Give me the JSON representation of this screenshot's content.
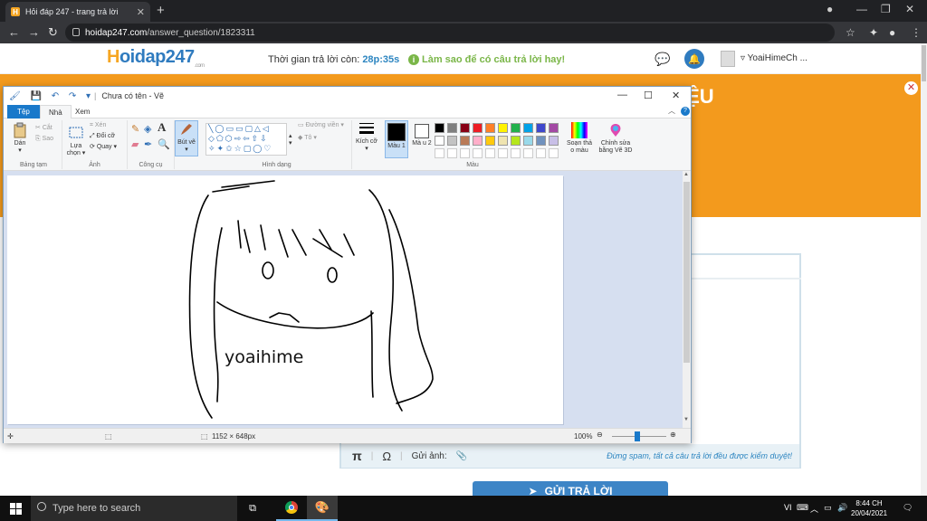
{
  "browser": {
    "tab_title": "Hỏi đáp 247 - trang trả lời",
    "url_host": "hoidap247.com",
    "url_path": "/answer_question/1823311"
  },
  "site": {
    "logo_main": "Hoidap247",
    "logo_sub": ".com",
    "timer_label": "Thời gian trả lời còn:",
    "timer_value": "28p:35s",
    "howto": "Làm sao để có câu trả lời hay!",
    "username": "YoaiHimeCh ...",
    "title_fragment": "IỆU",
    "answer_tools": {
      "pi": "π",
      "omega": "Ω",
      "image_label": "Gửi ảnh:",
      "note": "Đừng spam, tất cả câu trả lời đều được kiểm duyệt!"
    },
    "submit_label": "GỬI TRẢ LỜI"
  },
  "paint": {
    "doc_title": "Chưa có tên - Vẽ",
    "tabs": [
      "Tệp",
      "Nhà",
      "Xem"
    ],
    "groups": {
      "clipboard": "Bảng tạm",
      "image": "Ảnh",
      "tools": "Công cụ",
      "shapes": "Hình dạng",
      "colors": "Màu"
    },
    "buttons": {
      "paste": "Dán",
      "cut": "Cắt",
      "copy": "Sao",
      "select": "Lựa chọn",
      "crop": "Xén",
      "resize": "Đổi cỡ",
      "rotate": "Quay",
      "brush": "Bút vẽ",
      "outline": "Đường viền",
      "fill": "Tô",
      "size": "Kích cỡ",
      "color1": "Màu 1",
      "color2": "Mà u 2",
      "edit_colors": "Soạn thả o màu",
      "paint3d": "Chỉnh sửa bằng Vẽ 3D"
    },
    "canvas_text": "yoaihime",
    "status_size": "1152 × 648px",
    "zoom": "100%",
    "palette_row1": [
      "#000000",
      "#7f7f7f",
      "#880015",
      "#ed1c24",
      "#ff7f27",
      "#fff200",
      "#22b14c",
      "#00a2e8",
      "#3f48cc",
      "#a349a4"
    ],
    "palette_row2": [
      "#ffffff",
      "#c3c3c3",
      "#b97a57",
      "#ffaec9",
      "#ffc90e",
      "#efe4b0",
      "#b5e61d",
      "#99d9ea",
      "#7092be",
      "#c8bfe7"
    ]
  },
  "taskbar": {
    "search_placeholder": "Type here to search",
    "lang": "VI",
    "time": "8:44 CH",
    "date": "20/04/2021"
  },
  "colors": {
    "accent_orange": "#f39a1d",
    "site_blue": "#2f7bbf",
    "paint_blue": "#1979ca"
  }
}
